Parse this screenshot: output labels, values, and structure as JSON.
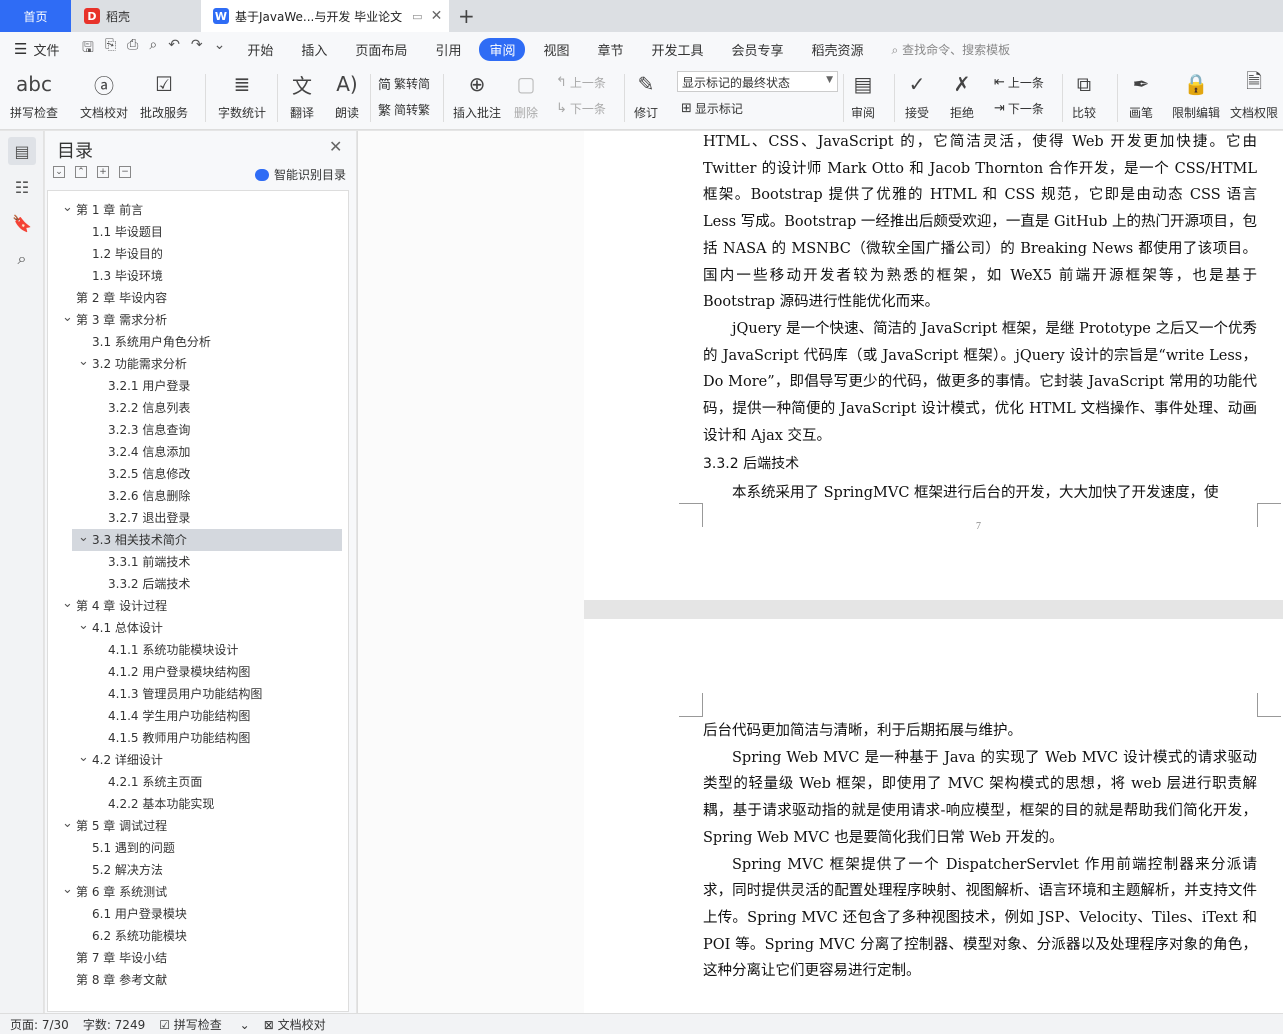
{
  "tabs": {
    "home": "首页",
    "daoke": "稻壳",
    "doc": "基于JavaWe...与开发 毕业论文"
  },
  "menu": {
    "file": "文件",
    "items": [
      "开始",
      "插入",
      "页面布局",
      "引用",
      "审阅",
      "视图",
      "章节",
      "开发工具",
      "会员专享",
      "稻壳资源"
    ],
    "active": "审阅",
    "search": "查找命令、搜索模板"
  },
  "ribbon": {
    "spell_check": "拼写检查",
    "doc_proof": "文档校对",
    "annotate_service": "批改服务",
    "word_count": "字数统计",
    "translate": "翻译",
    "read_aloud": "朗读",
    "trad_to_simp": "繁转简",
    "simp_to_trad": "简转繁",
    "insert_comment": "插入批注",
    "delete": "删除",
    "prev": "上一条",
    "next": "下一条",
    "revise": "修订",
    "markup_select": "显示标记的最终状态",
    "show_markup": "显示标记",
    "review": "审阅",
    "accept": "接受",
    "reject": "拒绝",
    "prev2": "上一条",
    "next2": "下一条",
    "compare": "比较",
    "pen": "画笔",
    "restrict_edit": "限制编辑",
    "doc_permission": "文档权限"
  },
  "toc": {
    "title": "目录",
    "smart": "智能识别目录",
    "items": [
      {
        "text": "第 1 章  前言",
        "level": 1,
        "chev": true
      },
      {
        "text": "1.1 毕设题目",
        "level": 2,
        "chev": false
      },
      {
        "text": "1.2 毕设目的",
        "level": 2,
        "chev": false
      },
      {
        "text": "1.3 毕设环境",
        "level": 2,
        "chev": false
      },
      {
        "text": "第 2 章  毕设内容",
        "level": 1,
        "chev": false
      },
      {
        "text": "第 3 章  需求分析",
        "level": 1,
        "chev": true
      },
      {
        "text": "3.1 系统用户角色分析",
        "level": 2,
        "chev": false
      },
      {
        "text": "3.2 功能需求分析",
        "level": 2,
        "chev": true
      },
      {
        "text": "3.2.1 用户登录",
        "level": 3,
        "chev": false
      },
      {
        "text": "3.2.2 信息列表",
        "level": 3,
        "chev": false
      },
      {
        "text": "3.2.3 信息查询",
        "level": 3,
        "chev": false
      },
      {
        "text": "3.2.4 信息添加",
        "level": 3,
        "chev": false
      },
      {
        "text": "3.2.5 信息修改",
        "level": 3,
        "chev": false
      },
      {
        "text": "3.2.6 信息删除",
        "level": 3,
        "chev": false
      },
      {
        "text": "3.2.7 退出登录",
        "level": 3,
        "chev": false
      },
      {
        "text": "3.3 相关技术简介",
        "level": 2,
        "chev": true,
        "selected": true
      },
      {
        "text": "3.3.1 前端技术",
        "level": 3,
        "chev": false
      },
      {
        "text": "3.3.2 后端技术",
        "level": 3,
        "chev": false
      },
      {
        "text": "第 4 章  设计过程",
        "level": 1,
        "chev": true
      },
      {
        "text": "4.1 总体设计",
        "level": 2,
        "chev": true
      },
      {
        "text": "4.1.1 系统功能模块设计",
        "level": 3,
        "chev": false
      },
      {
        "text": "4.1.2 用户登录模块结构图",
        "level": 3,
        "chev": false
      },
      {
        "text": "4.1.3 管理员用户功能结构图",
        "level": 3,
        "chev": false
      },
      {
        "text": "4.1.4 学生用户功能结构图",
        "level": 3,
        "chev": false
      },
      {
        "text": "4.1.5 教师用户功能结构图",
        "level": 3,
        "chev": false
      },
      {
        "text": "4.2 详细设计",
        "level": 2,
        "chev": true
      },
      {
        "text": "4.2.1 系统主页面",
        "level": 3,
        "chev": false
      },
      {
        "text": "4.2.2 基本功能实现",
        "level": 3,
        "chev": false
      },
      {
        "text": "第 5 章  调试过程",
        "level": 1,
        "chev": true
      },
      {
        "text": "5.1 遇到的问题",
        "level": 2,
        "chev": false
      },
      {
        "text": "5.2  解决方法",
        "level": 2,
        "chev": false
      },
      {
        "text": "第 6 章  系统测试",
        "level": 1,
        "chev": true
      },
      {
        "text": "6.1 用户登录模块",
        "level": 2,
        "chev": false
      },
      {
        "text": "6.2 系统功能模块",
        "level": 2,
        "chev": false
      },
      {
        "text": "第 7 章  毕设小结",
        "level": 1,
        "chev": false
      },
      {
        "text": "第 8 章  参考文献",
        "level": 1,
        "chev": false
      }
    ]
  },
  "page1": {
    "p1": "HTML、CSS、JavaScript 的，它简洁灵活，使得 Web 开发更加快捷。它由 Twitter 的设计师 Mark Otto 和 Jacob Thornton 合作开发，是一个 CSS/HTML 框架。Bootstrap 提供了优雅的 HTML 和 CSS 规范，它即是由动态 CSS 语言 Less 写成。Bootstrap 一经推出后颇受欢迎，一直是 GitHub 上的热门开源项目，包括 NASA 的 MSNBC（微软全国广播公司）的 Breaking News 都使用了该项目。国内一些移动开发者较为熟悉的框架，如 WeX5 前端开源框架等，也是基于 Bootstrap 源码进行性能优化而来。",
    "p2": "jQuery 是一个快速、简洁的 JavaScript 框架，是继 Prototype 之后又一个优秀的 JavaScript 代码库（或 JavaScript 框架）。jQuery 设计的宗旨是“write Less，Do More”，即倡导写更少的代码，做更多的事情。它封装 JavaScript 常用的功能代码，提供一种简便的 JavaScript 设计模式，优化 HTML 文档操作、事件处理、动画设计和 Ajax 交互。",
    "heading": "3.3.2 后端技术",
    "p3": "本系统采用了 SpringMVC 框架进行后台的开发，大大加快了开发速度，使",
    "page_number": "7"
  },
  "page2": {
    "p1": "后台代码更加简洁与清晰，利于后期拓展与维护。",
    "p2": "Spring Web MVC 是一种基于 Java 的实现了 Web MVC 设计模式的请求驱动类型的轻量级 Web 框架，即使用了 MVC 架构模式的思想，将 web 层进行职责解耦，基于请求驱动指的就是使用请求-响应模型，框架的目的就是帮助我们简化开发，Spring Web MVC 也是要简化我们日常 Web 开发的。",
    "p3": "Spring MVC 框架提供了一个 DispatcherServlet 作用前端控制器来分派请求，同时提供灵活的配置处理程序映射、视图解析、语言环境和主题解析，并支持文件上传。Spring MVC 还包含了多种视图技术，例如 JSP、Velocity、Tiles、iText 和 POI 等。Spring MVC 分离了控制器、模型对象、分派器以及处理程序对象的角色，这种分离让它们更容易进行定制。"
  },
  "status": {
    "page": "页面: 7/30",
    "words": "字数: 7249",
    "spell": "拼写检查",
    "proof": "文档校对"
  },
  "colors": {
    "accent": "#2f6cf5",
    "daoke_red": "#e8322a"
  }
}
